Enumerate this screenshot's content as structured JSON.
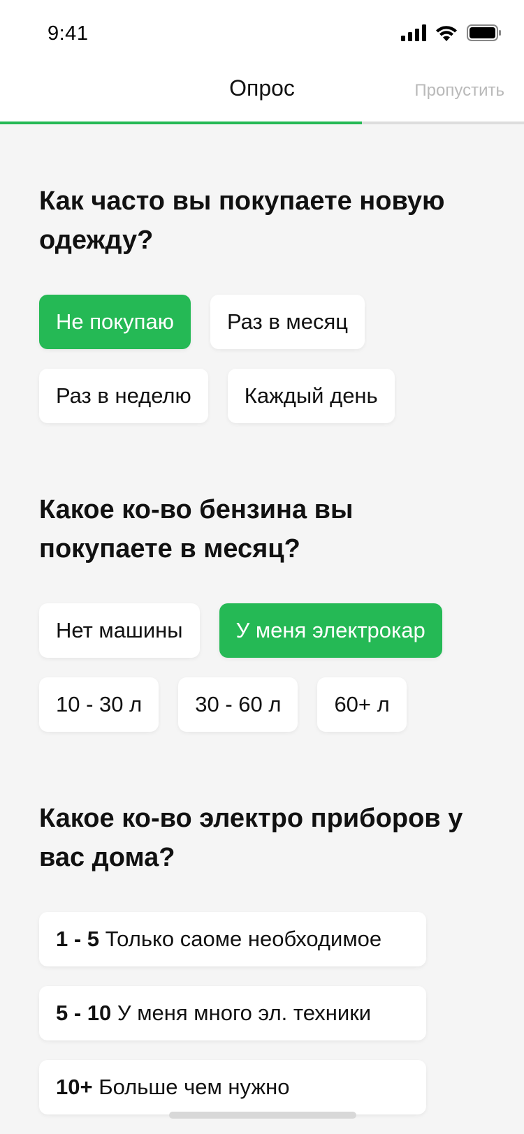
{
  "status_bar": {
    "time": "9:41",
    "icons": [
      "signal-icon",
      "wifi-icon",
      "battery-icon"
    ]
  },
  "header": {
    "title": "Опрос",
    "skip_label": "Пропустить",
    "progress": 0.69
  },
  "colors": {
    "accent": "#25b955",
    "background": "#f5f5f5",
    "skip_text": "#b9b9b9"
  },
  "questions": [
    {
      "text": "Как часто вы покупаете новую одежду?",
      "options": [
        {
          "label": "Не покупаю",
          "selected": true
        },
        {
          "label": "Раз в месяц",
          "selected": false
        },
        {
          "label": "Раз в неделю",
          "selected": false
        },
        {
          "label": "Каждый день",
          "selected": false
        }
      ]
    },
    {
      "text": "Какое ко-во бензина вы покупаете в месяц?",
      "options": [
        {
          "label": "Нет машины",
          "selected": false
        },
        {
          "label": "У меня электрокар",
          "selected": true
        },
        {
          "label": "10 - 30 л",
          "selected": false
        },
        {
          "label": "30 - 60 л",
          "selected": false
        },
        {
          "label": "60+ л",
          "selected": false
        }
      ]
    },
    {
      "text": "Какое ко-во электро приборов у вас дома?",
      "options": [
        {
          "range": "1 - 5",
          "label": "Только саоме необходимое",
          "selected": false
        },
        {
          "range": "5 - 10",
          "label": "У меня много эл. техники",
          "selected": false
        },
        {
          "range": "10+",
          "label": "Больше чем нужно",
          "selected": false
        }
      ]
    }
  ]
}
